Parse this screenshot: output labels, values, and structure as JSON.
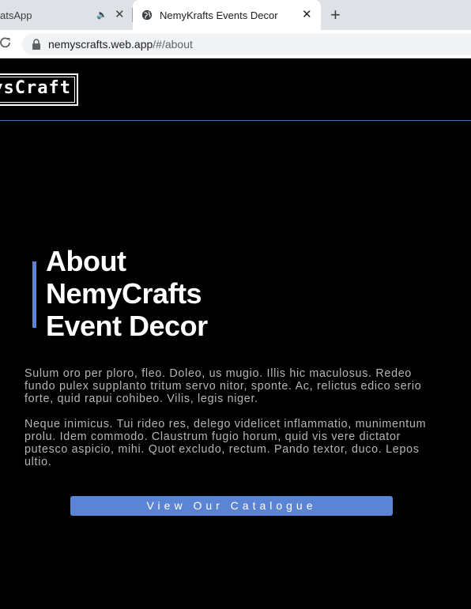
{
  "browser": {
    "tabs": [
      {
        "title": "atsApp",
        "active": false,
        "audio": true
      },
      {
        "title": "NemyKrafts Events Decor",
        "active": true
      }
    ],
    "new_tab": "+",
    "close_glyph": "✕",
    "url_host": "nemyscrafts.web.app",
    "url_path": "/#/about"
  },
  "site": {
    "brand": "ysCraft",
    "about_title": [
      "About",
      "NemyCrafts",
      "Event Decor"
    ],
    "paragraphs": [
      "Sulum oro per ploro, fleo. Doleo, us mugio. Illis hic maculosus. Redeo fundo pulex supplanto tritum servo nitor, sponte. Ac, relictus edico serio forte, quid rapui cohibeo. Vilis, legis niger.",
      "Neque inimicus. Tui rideo res, delego videlicet inflammatio, munimentum prolu. Idem commodo. Claustrum fugio horum, quid vis vere dictator putesco aspicio, mihi. Quot excludo, rectum. Pando textor, duco. Lepos ultio."
    ],
    "catalogue_button": "View Our Catalogue"
  },
  "colors": {
    "accent": "#5b84d4",
    "background": "#000000",
    "text": "#b6b6b6"
  }
}
